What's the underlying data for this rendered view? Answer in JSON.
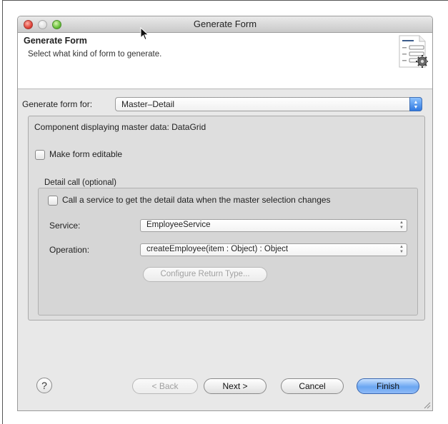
{
  "window": {
    "title": "Generate Form"
  },
  "header": {
    "title": "Generate Form",
    "subtitle": "Select what kind of form to generate.",
    "icon": "form-settings-icon"
  },
  "generate_for": {
    "label": "Generate form for:",
    "value": "Master–Detail"
  },
  "component_info": "Component displaying master data:  DataGrid",
  "make_editable": {
    "label": "Make form editable",
    "checked": false
  },
  "detail_call": {
    "group_label": "Detail call (optional)",
    "call_service": {
      "label": "Call a service to get the detail data when the master selection changes",
      "checked": false
    },
    "service": {
      "label": "Service:",
      "value": "EmployeeService"
    },
    "operation": {
      "label": "Operation:",
      "value": "createEmployee(item : Object) : Object"
    },
    "configure_button": "Configure Return Type..."
  },
  "footer": {
    "help": "?",
    "back": "< Back",
    "next": "Next >",
    "cancel": "Cancel",
    "finish": "Finish"
  },
  "colors": {
    "default_button": "#6aa6f2",
    "select_accent": "#2f78e0"
  }
}
